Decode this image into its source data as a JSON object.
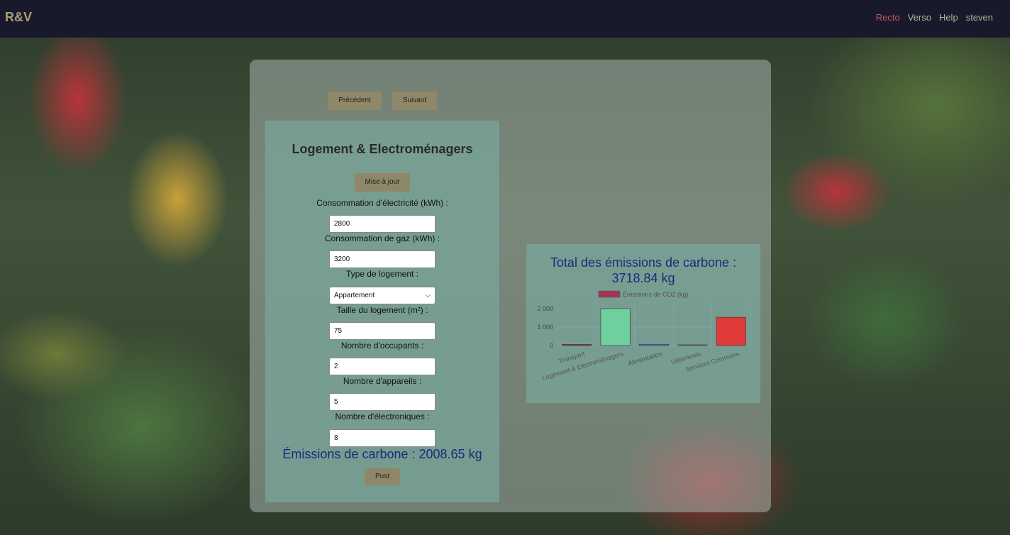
{
  "brand": "R&V",
  "nav": {
    "items": [
      {
        "label": "Recto",
        "active": true
      },
      {
        "label": "Verso",
        "active": false
      },
      {
        "label": "Help",
        "active": false
      },
      {
        "label": "steven",
        "active": false
      }
    ]
  },
  "pager": {
    "prev_label": "Précédent",
    "next_label": "Suivant"
  },
  "form": {
    "title": "Logement & Electroménagers",
    "update_label": "Mise à jour",
    "electricity_label": "Consommation d'électricité (kWh) :",
    "electricity_value": "2800",
    "gas_label": "Consommation de gaz (kWh) :",
    "gas_value": "3200",
    "housing_type_label": "Type de logement :",
    "housing_type_value": "Appartement",
    "size_label": "Taille du logement (m²) :",
    "size_value": "75",
    "occupants_label": "Nombre d'occupants :",
    "occupants_value": "2",
    "appliances_label": "Nombre d'appareils :",
    "appliances_value": "5",
    "electronics_label": "Nombre d'électroniques :",
    "electronics_value": "8",
    "result": "Émissions de carbone : 2008.65 kg",
    "post_label": "Post"
  },
  "total": {
    "line1": "Total des émissions de carbone :",
    "line2": "3718.84 kg"
  },
  "chart_data": {
    "type": "bar",
    "categories": [
      "Transport",
      "Logement & Electroménagers",
      "Alimentation",
      "Vêtements",
      "Services Communs"
    ],
    "series": [
      {
        "name": "Émissions de CO2 (kg)",
        "values": [
          60,
          2008.65,
          70,
          40,
          1540.19
        ]
      }
    ],
    "colors": [
      "#a2364f",
      "#6fcf9f",
      "#4a78c8",
      "#8a8a6a",
      "#e03a3a"
    ],
    "legend_color": "#a2364f",
    "yticks": [
      "0",
      "1 000",
      "2 000"
    ],
    "ylim": [
      0,
      2200
    ],
    "legend_position": "top",
    "grid": true
  }
}
